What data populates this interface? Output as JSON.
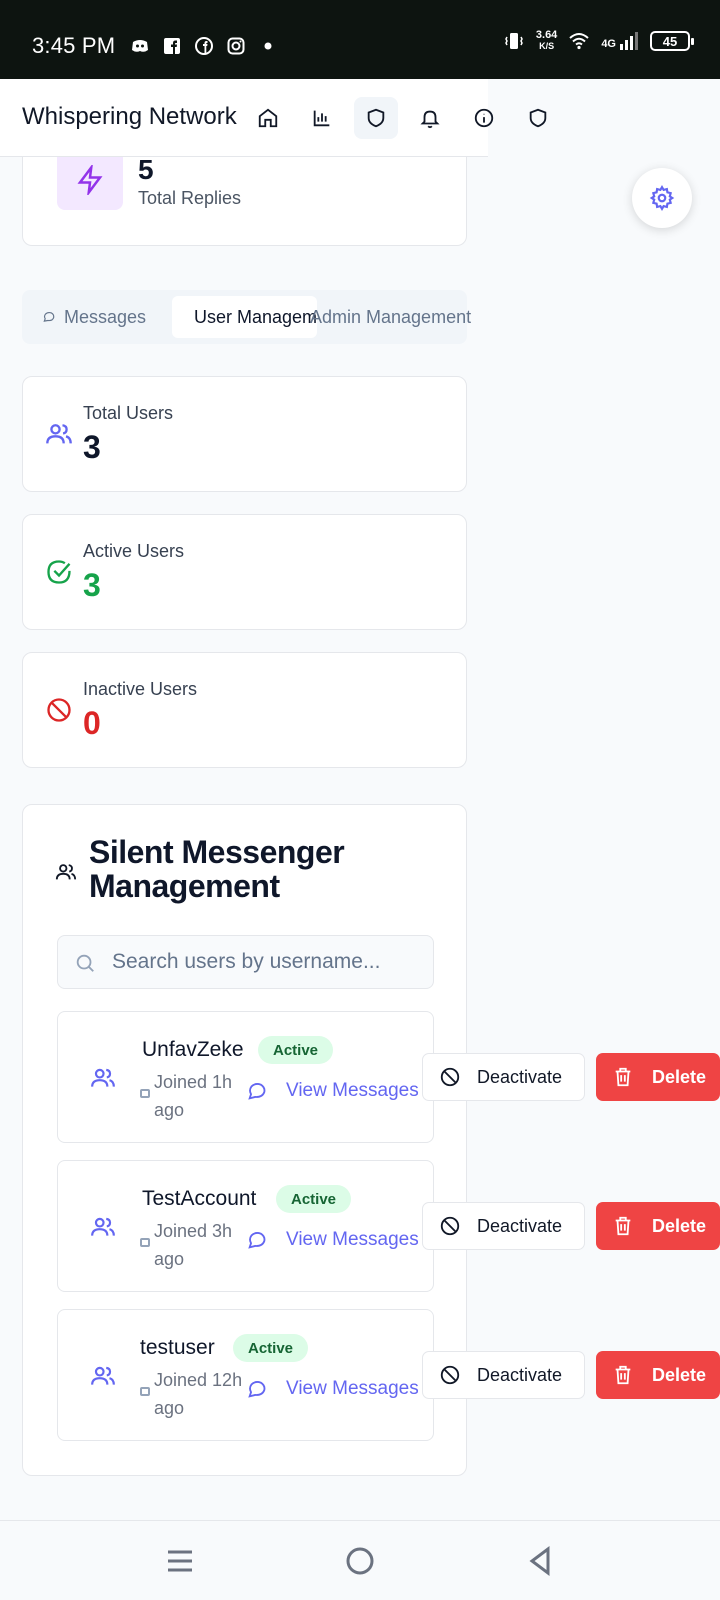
{
  "status_bar": {
    "time": "3:45 PM",
    "net_speed": "3.64",
    "net_unit": "K/S",
    "network": "4G",
    "battery": "45"
  },
  "header": {
    "title": "Whispering Network",
    "nav_icons": [
      "home-icon",
      "bar-chart-icon",
      "shield-icon",
      "bell-icon",
      "info-icon",
      "shield-icon"
    ]
  },
  "replies": {
    "value": "5",
    "label": "Total Replies"
  },
  "tabs": [
    {
      "label": "Messages"
    },
    {
      "label": "User Management"
    },
    {
      "label": "Admin Management"
    }
  ],
  "stats": [
    {
      "label": "Total Users",
      "value": "3",
      "color": "#0f172a"
    },
    {
      "label": "Active Users",
      "value": "3",
      "color": "#16a34a"
    },
    {
      "label": "Inactive Users",
      "value": "0",
      "color": "#dc2626"
    }
  ],
  "management": {
    "title": "Silent Messenger Management",
    "search_placeholder": "Search users by username...",
    "users": [
      {
        "username": "UnfavZeke",
        "status": "Active",
        "joined": "Joined 1h ago",
        "view_label": "View Messages",
        "deactivate_label": "Deactivate",
        "delete_label": "Delete"
      },
      {
        "username": "TestAccount",
        "status": "Active",
        "joined": "Joined 3h ago",
        "view_label": "View Messages",
        "deactivate_label": "Deactivate",
        "delete_label": "Delete"
      },
      {
        "username": "testuser",
        "status": "Active",
        "joined": "Joined 12h ago",
        "view_label": "View Messages",
        "deactivate_label": "Deactivate",
        "delete_label": "Delete"
      }
    ]
  },
  "colors": {
    "accent": "#6366f1",
    "danger": "#ef4444",
    "success": "#16a34a"
  }
}
